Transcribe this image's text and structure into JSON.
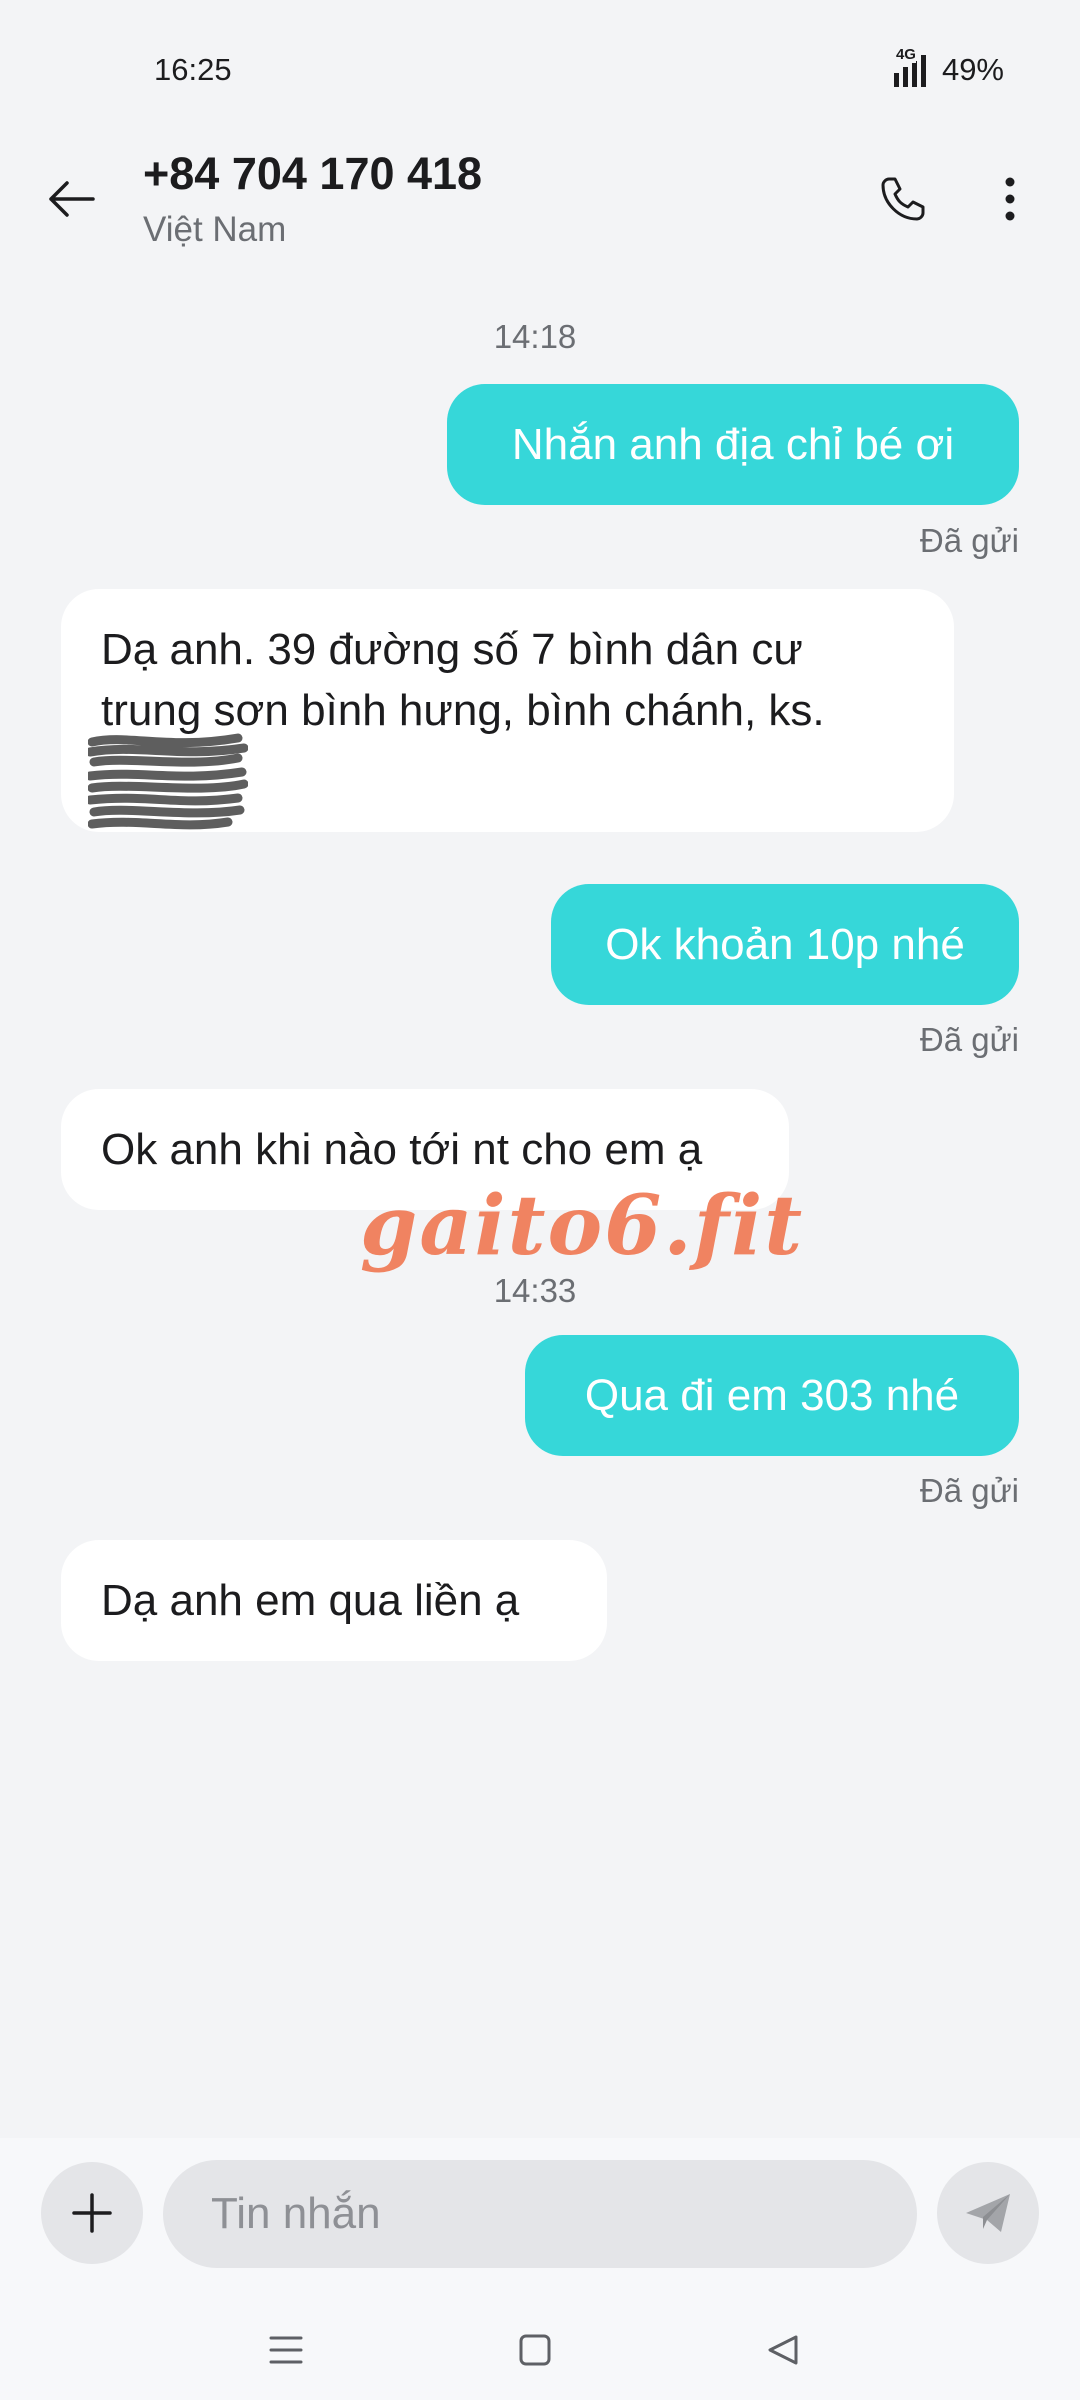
{
  "status_bar": {
    "time": "16:25",
    "network": "4G",
    "battery": "49%"
  },
  "header": {
    "contact_name": "+84 704 170 418",
    "contact_subtitle": "Việt Nam"
  },
  "messages": [
    {
      "type": "timestamp",
      "text": "14:18"
    },
    {
      "type": "outgoing",
      "text": "Nhắn anh địa chỉ bé ơi",
      "status": "Đã gửi"
    },
    {
      "type": "incoming",
      "lines": [
        "Dạ anh.  39 đường số 7 bình dân cư",
        "trung sơn bình hưng, bình chánh, ks."
      ]
    },
    {
      "type": "outgoing",
      "text": "Ok khoản 10p nhé",
      "status": "Đã gửi"
    },
    {
      "type": "incoming",
      "lines": [
        "Ok anh khi nào tới nt cho em ạ"
      ]
    },
    {
      "type": "timestamp",
      "text": "14:33"
    },
    {
      "type": "outgoing",
      "text": "Qua đi em 303 nhé",
      "status": "Đã gửi"
    },
    {
      "type": "incoming",
      "lines": [
        "Dạ anh em qua liền ạ"
      ]
    }
  ],
  "watermark": "gaito6.fit",
  "composer": {
    "placeholder": "Tin nhắn",
    "value": ""
  },
  "colors": {
    "outgoing_bubble": "#36d7d9",
    "incoming_bubble": "#ffffff",
    "background": "#f3f4f6",
    "watermark": "#f07a55"
  },
  "icons": {
    "back": "arrow-left-icon",
    "call": "phone-icon",
    "more": "more-vertical-icon",
    "add": "plus-icon",
    "send": "send-icon",
    "nav_menu": "menu-icon",
    "nav_home": "square-icon",
    "nav_back": "triangle-back-icon"
  }
}
